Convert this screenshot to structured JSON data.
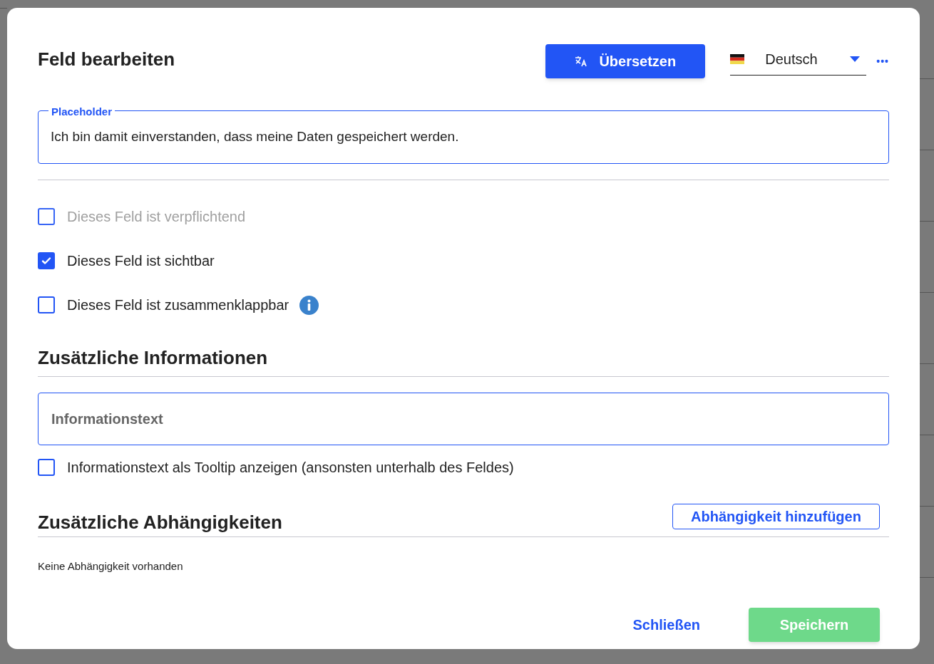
{
  "dialog": {
    "title": "Feld bearbeiten",
    "translate_button": "Übersetzen",
    "language": {
      "value": "Deutsch"
    },
    "more_button": "•••",
    "placeholder_field": {
      "label": "Placeholder",
      "value": "Ich bin damit einverstanden, dass meine Daten gespeichert werden."
    },
    "options": [
      {
        "label": "Dieses Feld ist verpflichtend",
        "checked": false,
        "disabled": true,
        "info": false
      },
      {
        "label": "Dieses Feld ist sichtbar",
        "checked": true,
        "disabled": false,
        "info": false
      },
      {
        "label": "Dieses Feld ist zusammenklappbar",
        "checked": false,
        "disabled": false,
        "info": true
      }
    ],
    "info_section": {
      "heading": "Zusätzliche Informationen",
      "field_placeholder": "Informationstext",
      "tooltip_option": {
        "label": "Informationstext als Tooltip anzeigen (ansonsten unterhalb des Feldes)",
        "checked": false
      }
    },
    "dependencies": {
      "heading": "Zusätzliche Abhängigkeiten",
      "add_button": "Abhängigkeit hinzufügen",
      "empty_text": "Keine Abhängigkeit vorhanden"
    },
    "buttons": [
      {
        "label": "Schließen",
        "kind": "text"
      },
      {
        "label": "Speichern",
        "kind": "primary",
        "disabled": true
      }
    ]
  }
}
